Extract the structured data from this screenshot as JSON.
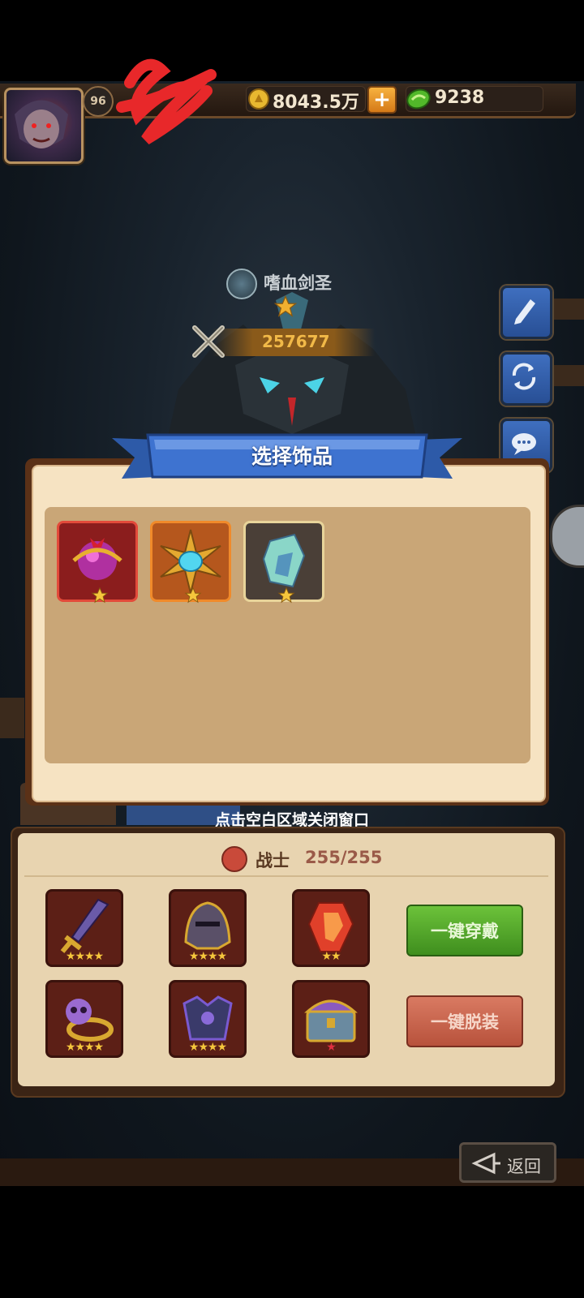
{
  "topbar": {
    "level": "96",
    "gold": "8043.5万",
    "gems": "9238",
    "plus_label": "+"
  },
  "hero": {
    "name": "嗜血剑圣",
    "power": "257677"
  },
  "modal": {
    "title": "选择饰品",
    "items": [
      {
        "name": "pink-orb-accessory",
        "frame_color": "#8b1d1d",
        "stars": 1
      },
      {
        "name": "golden-sun-amulet",
        "frame_color": "#b5571d",
        "stars": 1
      },
      {
        "name": "crystal-stone",
        "frame_color": "#4a3f37",
        "stars": 1
      }
    ],
    "close_hint": "点击空白区域关闭窗口"
  },
  "equipment": {
    "class_label": "战士",
    "count": "255/255",
    "slots": [
      {
        "name": "sword-slot",
        "stars": "★★★★"
      },
      {
        "name": "helmet-slot",
        "stars": "★★★★"
      },
      {
        "name": "red-gem-slot",
        "stars": "★★"
      },
      {
        "name": "skull-ring-slot",
        "stars": "★★★★"
      },
      {
        "name": "armor-slot",
        "stars": "★★★★"
      },
      {
        "name": "chest-slot",
        "stars": "★"
      }
    ],
    "equip_all": "一键穿戴",
    "unequip_all": "一键脱装"
  },
  "footer": {
    "back": "返回"
  },
  "colors": {
    "modal_title_blue": "#3b6fcf",
    "green_button": "#4fa22a",
    "red_button": "#c8624a"
  }
}
